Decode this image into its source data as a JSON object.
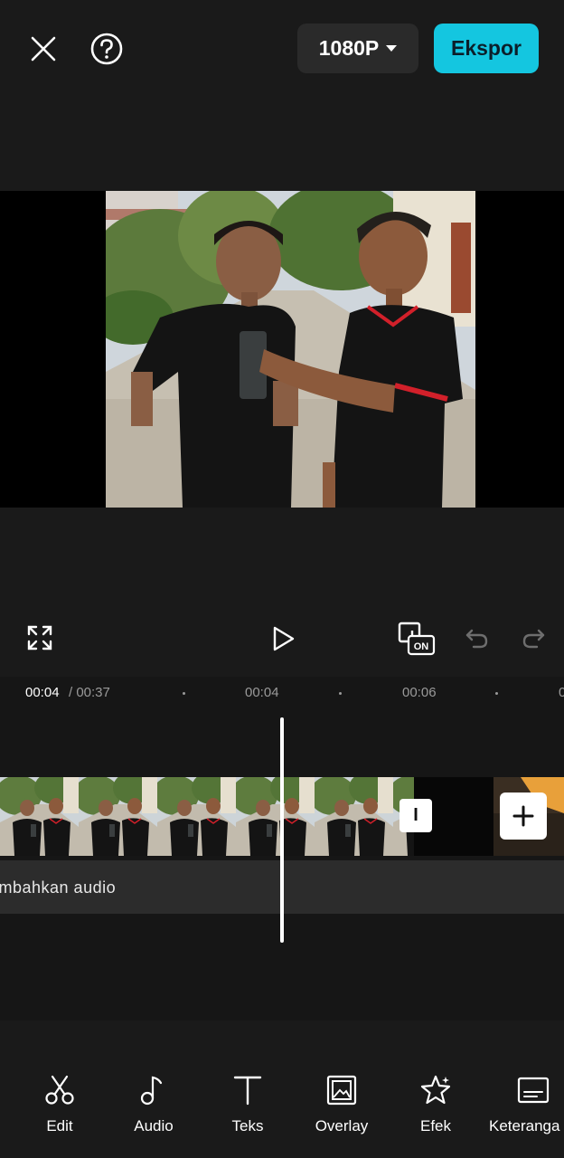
{
  "header": {
    "close_icon": "close-icon",
    "help_icon": "question-circle-icon",
    "resolution_label": "1080P",
    "export_label": "Ekspor"
  },
  "controls": {
    "fullscreen_icon": "fullscreen-icon",
    "play_icon": "play-icon",
    "keyframe_icon": "keyframe-on-icon",
    "keyframe_badge": "ON",
    "undo_icon": "undo-icon",
    "redo_icon": "redo-icon"
  },
  "timeline": {
    "current_time": "00:04",
    "total_time": "/ 00:37",
    "markers": [
      "00:04",
      "00:06",
      "0"
    ],
    "transition_label": "I",
    "audio_label": "ambahkan audio"
  },
  "toolbar": {
    "items": [
      {
        "label": "Edit",
        "icon": "scissors-icon"
      },
      {
        "label": "Audio",
        "icon": "music-note-icon"
      },
      {
        "label": "Teks",
        "icon": "text-icon"
      },
      {
        "label": "Overlay",
        "icon": "overlay-icon"
      },
      {
        "label": "Efek",
        "icon": "star-effect-icon"
      },
      {
        "label": "Keteranga",
        "icon": "caption-icon"
      }
    ]
  },
  "colors": {
    "accent": "#14c6e0",
    "background": "#1a1a1a",
    "timeline_bg": "#161616",
    "audio_track": "#2c2c2c"
  }
}
